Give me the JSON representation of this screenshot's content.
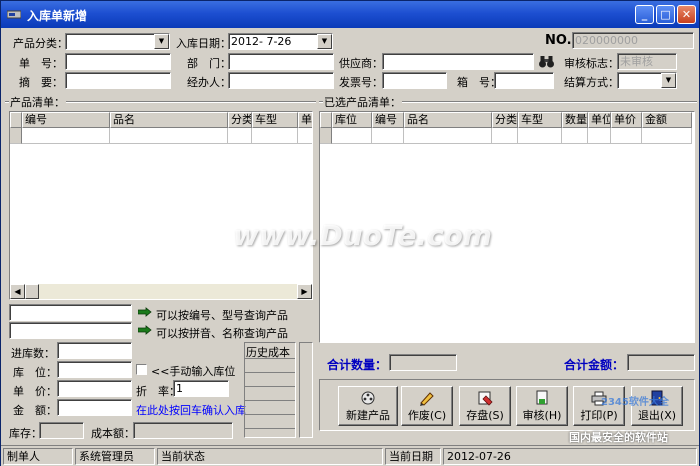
{
  "window": {
    "title": "入库单新增",
    "min": "_",
    "max": "□",
    "close": "✕"
  },
  "header": {
    "category_label": "产品分类：",
    "category_value": "",
    "date_label": "入库日期：",
    "date_value": "2012- 7-26",
    "no_label": "NO.",
    "no_value": "020000000",
    "order_label": "单　号：",
    "order_value": "",
    "dept_label": "部　门：",
    "dept_value": "",
    "supplier_label": "供应商：",
    "supplier_value": "",
    "audit_label": "审核标志：",
    "audit_value": "未审核",
    "summary_label": "摘　要：",
    "summary_value": "",
    "handler_label": "经办人：",
    "handler_value": "",
    "invoice_label": "发票号：",
    "invoice_value": "",
    "box_label": "箱　号：",
    "box_value": "",
    "settle_label": "结算方式：",
    "settle_value": ""
  },
  "product_list": {
    "title": "产品清单：",
    "columns": [
      "编号",
      "品名",
      "分类",
      "车型",
      "单价"
    ]
  },
  "selected_list": {
    "title": "已选产品清单：",
    "columns": [
      "库位",
      "编号",
      "品名",
      "分类",
      "车型",
      "数量",
      "单位",
      "单价",
      "金额"
    ]
  },
  "search": {
    "hint1": "可以按编号、型号查询产品",
    "hint2": "可以按拼音、名称查询产品"
  },
  "entry": {
    "qty_label": "进库数：",
    "qty_value": "",
    "loc_label": "库　位：",
    "loc_value": "",
    "manual_loc": "<<手动输入库位",
    "price_label": "单　价：",
    "price_value": "",
    "discount_label": "折　率：",
    "discount_value": "1",
    "amount_label": "金　额：",
    "amount_value": "",
    "confirm_hint": "在此处按回车确认入库",
    "stock_label": "库存：",
    "stock_value": "",
    "cost_label": "成本额：",
    "cost_value": "",
    "history_label": "历史成本"
  },
  "totals": {
    "qty_label": "合计数量：",
    "qty_value": "",
    "amount_label": "合计金额：",
    "amount_value": ""
  },
  "buttons": {
    "new": "新建产品",
    "void": "作废(C)",
    "save": "存盘(S)",
    "audit": "审核(H)",
    "print": "打印(P)",
    "exit": "退出(X)"
  },
  "status": {
    "maker_label": "制单人",
    "maker_value": "系统管理员",
    "state_label": "当前状态",
    "state_value": "",
    "date_label": "当前日期",
    "date_value": "2012-07-26"
  },
  "watermarks": {
    "main": "www.DuoTe.com",
    "corner_top": "2345软件大全",
    "corner_bottom": "国内最安全的软件站"
  },
  "colors": {
    "titlebar": "#1d4fd1",
    "face": "#d4d0c8",
    "total_label": "#0000c0"
  }
}
